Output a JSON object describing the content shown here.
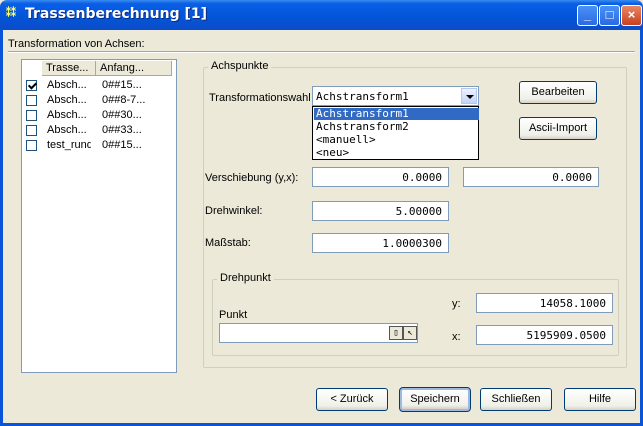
{
  "window": {
    "title": "Trassenberechnung [1]",
    "app_icon": "app-icon"
  },
  "section": {
    "title": "Transformation von Achsen:"
  },
  "list": {
    "columns": [
      "Trasse...",
      "Anfang..."
    ],
    "rows": [
      {
        "checked": true,
        "name": "Absch...",
        "start": "0##15..."
      },
      {
        "checked": false,
        "name": "Absch...",
        "start": "0##8-7..."
      },
      {
        "checked": false,
        "name": "Absch...",
        "start": "0##30..."
      },
      {
        "checked": false,
        "name": "Absch...",
        "start": "0##33..."
      },
      {
        "checked": false,
        "name": "test_rund",
        "start": "0##15..."
      }
    ]
  },
  "achspunkte": {
    "title": "Achspunkte",
    "transform_label": "Transformationswahl",
    "transform_value": "Achstransform1",
    "transform_options": [
      "Achstransform1",
      "Achstransform2",
      "<manuell>",
      "<neu>"
    ],
    "edit_button": "Bearbeiten",
    "ascii_button": "Ascii-Import",
    "shift_label": "Verschiebung (y,x):",
    "shift_y": "0.0000",
    "shift_x": "0.0000",
    "angle_label": "Drehwinkel:",
    "angle_value": "5.00000",
    "scale_label": "Maßstab:",
    "scale_value": "1.0000300"
  },
  "drehpunkt": {
    "title": "Drehpunkt",
    "point_label": "Punkt",
    "point_value": "",
    "y_label": "y:",
    "y_value": "14058.1000",
    "x_label": "x:",
    "x_value": "5195909.0500"
  },
  "footer": {
    "back": "< Zurück",
    "save": "Speichern",
    "close": "Schließen",
    "help": "Hilfe"
  }
}
